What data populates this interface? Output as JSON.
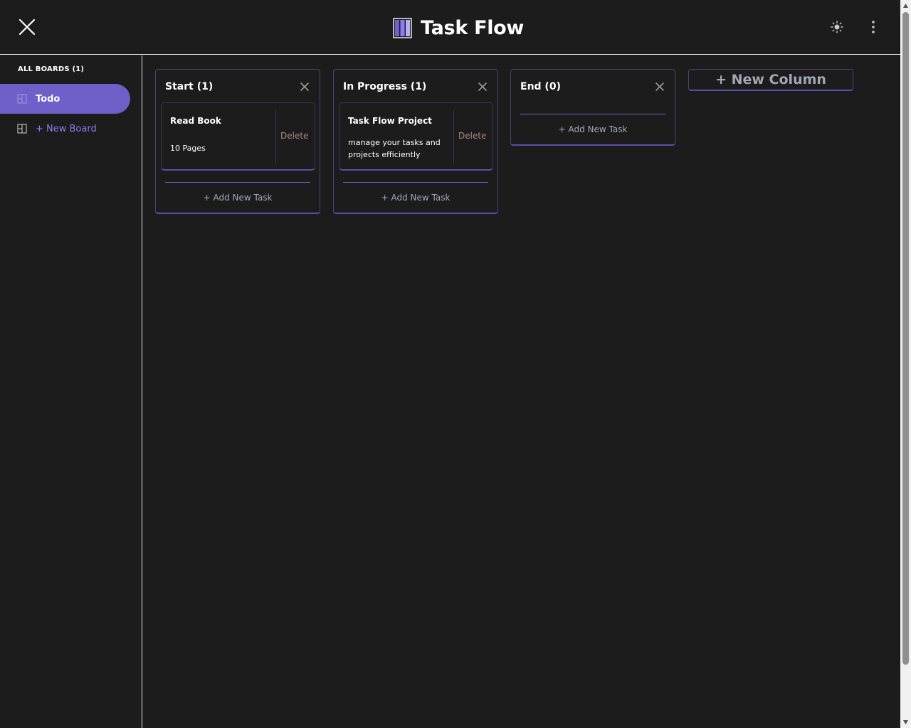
{
  "app": {
    "title": "Task Flow",
    "accent_color": "#6e5fc9"
  },
  "header": {
    "close_icon": "close-icon",
    "logo_icon": "board-logo-icon",
    "theme_icon": "sun-icon",
    "menu_icon": "more-vertical-icon"
  },
  "sidebar": {
    "heading": "ALL BOARDS (1)",
    "items": [
      {
        "label": "Todo",
        "icon": "board-icon",
        "active": true
      }
    ],
    "new_board_label": "+ New Board"
  },
  "columns": [
    {
      "title": "Start (1)",
      "tasks": [
        {
          "title": "Read Book",
          "description": "10 Pages",
          "delete_label": "Delete"
        }
      ],
      "add_task_label": "+ Add New Task"
    },
    {
      "title": "In Progress (1)",
      "tasks": [
        {
          "title": "Task Flow Project",
          "description": "manage your tasks and projects efficiently",
          "delete_label": "Delete"
        }
      ],
      "add_task_label": "+ Add New Task"
    },
    {
      "title": "End (0)",
      "tasks": [],
      "add_task_label": "+ Add New Task"
    }
  ],
  "new_column_label": "+ New Column"
}
